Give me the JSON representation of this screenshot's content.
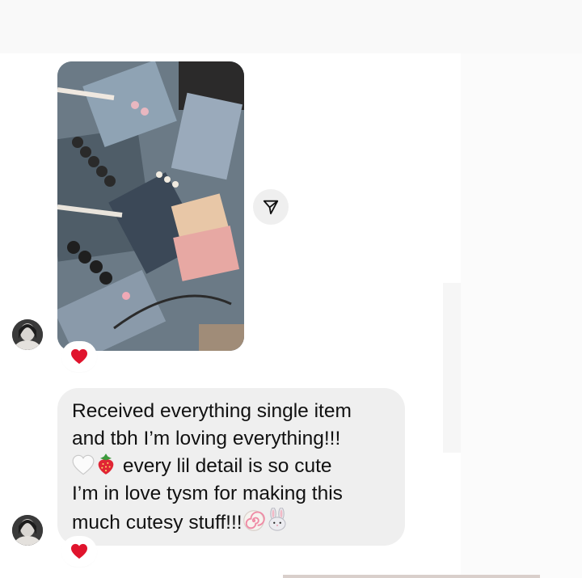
{
  "thread": {
    "messages": [
      {
        "type": "photo",
        "photo_subject": "packaged handmade jewelry with business cards",
        "reaction": "heart"
      },
      {
        "type": "text",
        "lines": [
          "Received everything single item",
          "and tbh I’m loving everything!!!",
          "every lil detail is so cute",
          "I’m in love tysm for making this",
          "much cutesy stuff!!!"
        ],
        "emojis": [
          "white-heart",
          "strawberry",
          "fish-cake",
          "rabbit-face"
        ],
        "reaction": "heart"
      }
    ]
  },
  "icons": {
    "share": "send-arrow-icon",
    "avatar": "user-avatar",
    "reaction": "red-heart-icon"
  },
  "colors": {
    "bubble": "#efefef",
    "heart": "#e0142d",
    "share_button": "#efefef"
  }
}
